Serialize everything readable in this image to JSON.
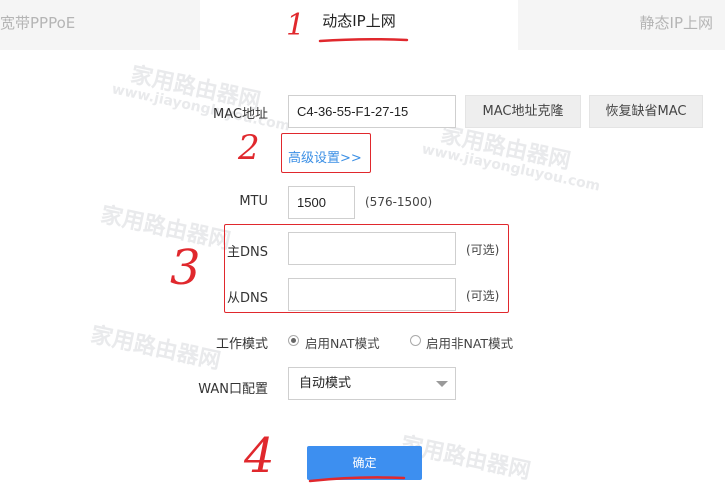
{
  "tabs": {
    "left": "宽带PPPoE",
    "center": "动态IP上网",
    "right": "静态IP上网"
  },
  "mac": {
    "label": "MAC地址",
    "value": "C4-36-55-F1-27-15",
    "clone_button": "MAC地址克隆",
    "restore_button": "恢复缺省MAC"
  },
  "advanced_link": "高级设置>>",
  "mtu": {
    "label": "MTU",
    "value": "1500",
    "range": "(576-1500)"
  },
  "dns": {
    "primary_label": "主DNS",
    "primary_value": "",
    "primary_hint": "(可选)",
    "secondary_label": "从DNS",
    "secondary_value": "",
    "secondary_hint": "(可选)"
  },
  "work_mode": {
    "label": "工作模式",
    "option_nat": "启用NAT模式",
    "option_non_nat": "启用非NAT模式",
    "selected": "启用NAT模式"
  },
  "wan": {
    "label": "WAN口配置",
    "selected": "自动模式"
  },
  "confirm_button": "确定",
  "annotations": {
    "one": "1",
    "two": "2",
    "three": "3",
    "four": "4"
  },
  "watermark": {
    "brand": "家用路由器网",
    "url": "www.jiayongluyou.com"
  },
  "colors": {
    "accent_blue": "#3d8ff0",
    "link_blue": "#3b8fe5",
    "annotation_red": "#e0282d"
  }
}
